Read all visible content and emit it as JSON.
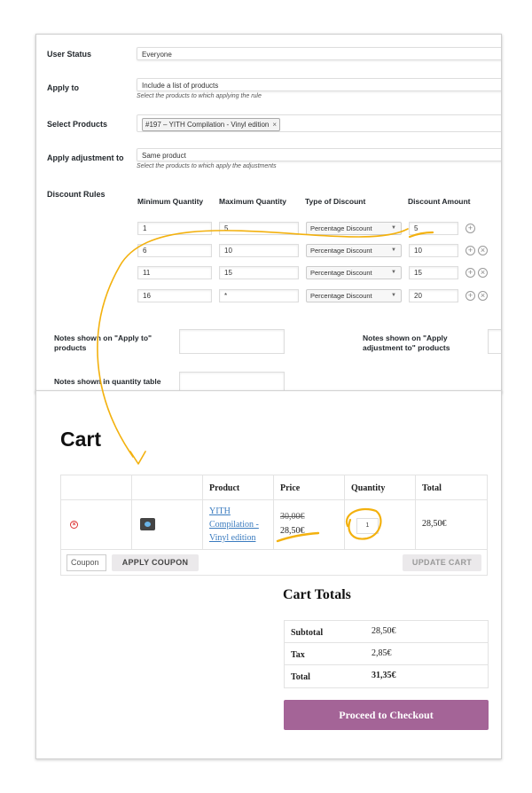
{
  "admin": {
    "user_status": {
      "label": "User Status",
      "value": "Everyone"
    },
    "apply_to": {
      "label": "Apply to",
      "value": "Include a list of products",
      "hint": "Select the products to which applying the rule"
    },
    "select_products": {
      "label": "Select Products",
      "tag": "#197 – YITH Compilation - Vinyl edition",
      "tag_remove": "×"
    },
    "apply_adjustment": {
      "label": "Apply adjustment to",
      "value": "Same product",
      "hint": "Select the products to which apply the adjustments"
    },
    "discount_rules": {
      "label": "Discount Rules",
      "headers": [
        "Minimum Quantity",
        "Maximum Quantity",
        "Type of Discount",
        "Discount Amount"
      ],
      "rows": [
        {
          "min": "1",
          "max": "5",
          "type": "Percentage Discount",
          "amount": "5"
        },
        {
          "min": "6",
          "max": "10",
          "type": "Percentage Discount",
          "amount": "10"
        },
        {
          "min": "11",
          "max": "15",
          "type": "Percentage Discount",
          "amount": "15"
        },
        {
          "min": "16",
          "max": "*",
          "type": "Percentage Discount",
          "amount": "20"
        }
      ],
      "add_symbol": "+",
      "remove_symbol": "×"
    },
    "notes_apply_to": "Notes shown on \"Apply to\" products",
    "notes_adjustment": "Notes shown on \"Apply adjustment to\" products",
    "notes_quantity": "Notes shown in quantity table"
  },
  "cart": {
    "title": "Cart",
    "headers": [
      "Product",
      "Price",
      "Quantity",
      "Total"
    ],
    "item": {
      "product": "YITH Compilation - Vinyl edition",
      "old_price": "30,00€",
      "price": "28,50€",
      "quantity": "1",
      "total": "28,50€",
      "remove_symbol": "×"
    },
    "coupon_placeholder": "Coupon",
    "apply_coupon": "APPLY COUPON",
    "update_cart": "UPDATE CART"
  },
  "totals": {
    "title": "Cart Totals",
    "rows": [
      {
        "label": "Subtotal",
        "value": "28,50€"
      },
      {
        "label": "Tax",
        "value": "2,85€"
      },
      {
        "label": "Total",
        "value": "31,35€"
      }
    ],
    "checkout": "Proceed to Checkout"
  },
  "colors": {
    "annotation": "#f3b10e",
    "checkout_button": "#a46497",
    "link": "#3a7bbf"
  }
}
